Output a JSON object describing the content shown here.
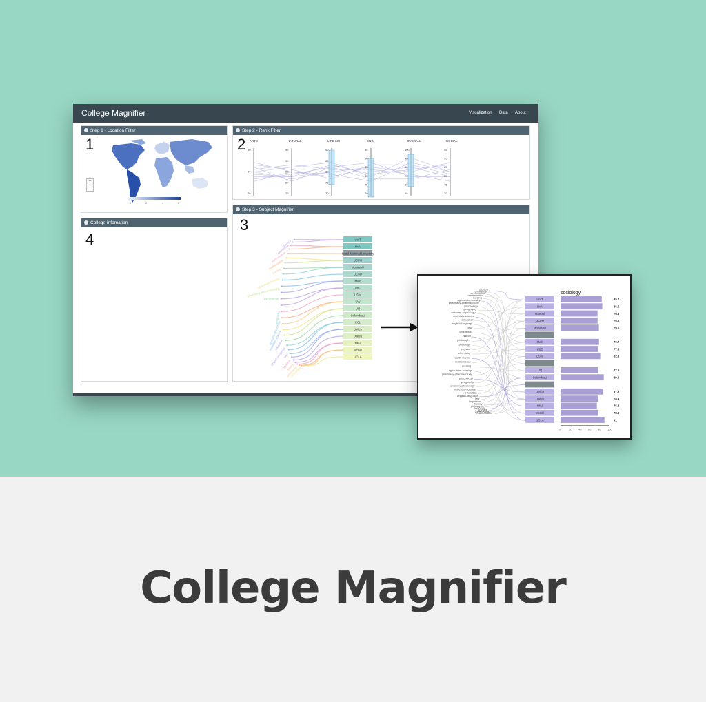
{
  "app": {
    "title": "College Magnifier",
    "nav": [
      "Visualization",
      "Data",
      "About"
    ]
  },
  "step1": {
    "title": "Step 1 - Location Filter",
    "number": "1",
    "zoom_in": "+",
    "zoom_out": "-",
    "legend_ticks": [
      "0",
      "2",
      "4",
      "6"
    ]
  },
  "step2": {
    "title": "Step 2 - Rank Filter",
    "number": "2",
    "axes": [
      {
        "label": "ARTS",
        "ticks": [
          "90",
          "80",
          "70"
        ]
      },
      {
        "label": "NATURAL",
        "ticks": [
          "95",
          "90",
          "85",
          "80",
          "75"
        ]
      },
      {
        "label": "LIFE SCI",
        "ticks": [
          "90",
          "85",
          "80",
          "75",
          "70"
        ]
      },
      {
        "label": "ENG",
        "ticks": [
          "95",
          "90",
          "85",
          "80",
          "75",
          "70"
        ]
      },
      {
        "label": "OVERALL",
        "ticks": [
          "100",
          "90",
          "80",
          "70",
          "60",
          "50"
        ]
      },
      {
        "label": "SOCIAL",
        "ticks": [
          "95",
          "90",
          "85",
          "80",
          "75",
          "70"
        ]
      }
    ]
  },
  "step3": {
    "title": "Step 3 - Subject Magnifier",
    "number": "3",
    "universities": [
      "UofT",
      "UvA",
      "Seoul National University",
      "UCPH",
      "MonashU",
      "UCSD",
      "Melb",
      "UBC",
      "USyd",
      "UW",
      "UQ",
      "ColumbiaU",
      "KCL",
      "UMich",
      "DukeU",
      "HKU",
      "McGill",
      "UCLA"
    ],
    "subjects": [
      "physics",
      "chemistry",
      "earth-marine",
      "mathematics",
      "nursing",
      "agriculture-forestry",
      "pharmacy-pharmacology",
      "psychology",
      "geography",
      "anatomy-physiology",
      "materials-science",
      "education",
      "english-language",
      "law",
      "linguistics",
      "history",
      "philosophy",
      "sociology"
    ]
  },
  "step4": {
    "title": "College Infomation",
    "number": "4"
  },
  "inset": {
    "subject": "sociology",
    "universities": [
      "UofT",
      "UvA",
      "USeoul",
      "UCPH",
      "MonashU",
      "",
      "Melb",
      "UBC",
      "USyd",
      "",
      "UQ",
      "ColumbiaU",
      "",
      "UMich",
      "DukeU",
      "HKU",
      "McGill",
      "UCLA"
    ],
    "values": [
      "85.4",
      "86.5",
      "76.6",
      "76.8",
      "79.5",
      "",
      "79.7",
      "77.3",
      "82.3",
      "",
      "77.6",
      "89.6",
      "",
      "87.9",
      "78.4",
      "75.3",
      "78.3",
      "91"
    ],
    "x_ticks": [
      "0",
      "20",
      "40",
      "60",
      "80",
      "100"
    ]
  },
  "caption": {
    "title": "College Magnifier"
  },
  "colors": {
    "background": "#98d7c4",
    "navbar": "#37464f",
    "panel_header": "#4f6470",
    "map_blue": "#2950a8",
    "inset_bar": "#a99fd4"
  }
}
